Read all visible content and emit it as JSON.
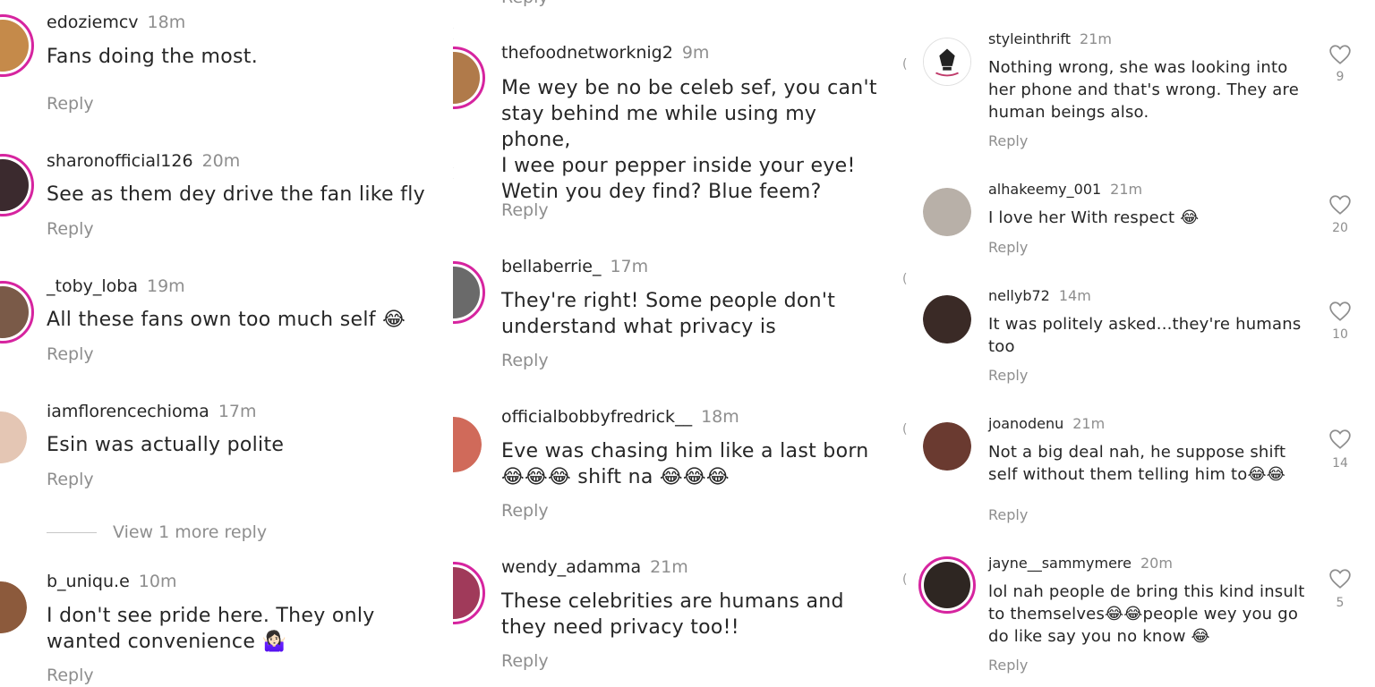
{
  "reply_label": "Reply",
  "view_more_label": "View 1 more reply",
  "colors": {
    "ring": "#d6249f",
    "muted": "#8e8e8e",
    "text": "#262626"
  },
  "col1": [
    {
      "user": "edoziemcv",
      "time": "18m",
      "text": "Fans doing the most."
    },
    {
      "user": "sharonofficial126",
      "time": "20m",
      "text": "See as them dey drive the fan like fly"
    },
    {
      "user": "_toby_loba",
      "time": "19m",
      "text": "All these fans own too much self 😂"
    },
    {
      "user": "iamflorencechioma",
      "time": "17m",
      "text": "Esin was actually polite"
    },
    {
      "user": "b_uniqu.e",
      "time": "10m",
      "text": "I don't see pride here. They only\nwanted convenience 🤷🏻‍♀️"
    }
  ],
  "col2": [
    {
      "user": "thefoodnetworknig2",
      "time": "9m",
      "text": "Me wey be no be celeb sef, you can't\nstay behind me while using my phone,\nI wee pour pepper inside your eye!\nWetin you dey find? Blue feem?"
    },
    {
      "user": "bellaberrie_",
      "time": "17m",
      "text": "They're right! Some people don't\nunderstand what privacy is"
    },
    {
      "user": "officialbobbyfredrick__",
      "time": "18m",
      "text": "Eve was chasing him like a last born\n😂😂😂 shift na 😂😂😂"
    },
    {
      "user": "wendy_adamma",
      "time": "21m",
      "text": "These celebrities are humans and\nthey need privacy too!!"
    }
  ],
  "col3": [
    {
      "user": "styleinthrift",
      "time": "21m",
      "text": "Nothing wrong, she was looking into\nher phone and that's wrong. They are\nhuman beings also.",
      "likes": "9"
    },
    {
      "user": "alhakeemy_001",
      "time": "21m",
      "text": "I love her With respect 😂",
      "likes": "20"
    },
    {
      "user": "nellyb72",
      "time": "14m",
      "text": "It was politely asked...they're humans\ntoo",
      "likes": "10"
    },
    {
      "user": "joanodenu",
      "time": "21m",
      "text": "Not a big deal nah, he suppose shift\nself without them telling him to😂😂",
      "likes": "14"
    },
    {
      "user": "jayne__sammymere",
      "time": "20m",
      "text": "lol nah people de bring this kind insult\nto themselves😂😂people wey you go\ndo like say you no know 😂",
      "likes": "5"
    }
  ]
}
